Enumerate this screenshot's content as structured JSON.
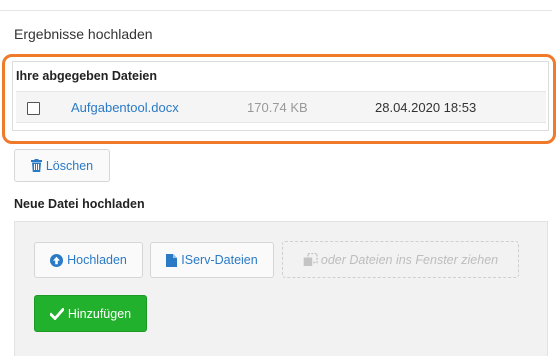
{
  "section": {
    "title": "Ergebnisse hochladen"
  },
  "submitted": {
    "heading": "Ihre abgegeben Dateien",
    "files": [
      {
        "name": "Aufgabentool.docx",
        "size": "170.74 KB",
        "date": "28.04.2020 18:53",
        "checked": false
      }
    ]
  },
  "actions": {
    "delete_label": "Löschen"
  },
  "new_upload": {
    "title": "Neue Datei hochladen",
    "upload_label": "Hochladen",
    "iserv_label": "IServ-Dateien",
    "drop_label": "oder Dateien ins Fenster ziehen",
    "add_label": "Hinzufügen"
  },
  "colors": {
    "link": "#2a7ac6",
    "highlight": "#f07a2a",
    "success": "#22b12c"
  },
  "icons": {
    "delete": "trash-icon",
    "upload": "arrow-up-circle-icon",
    "iserv": "file-icon",
    "drop": "copy-icon",
    "add": "checkmark-icon"
  }
}
